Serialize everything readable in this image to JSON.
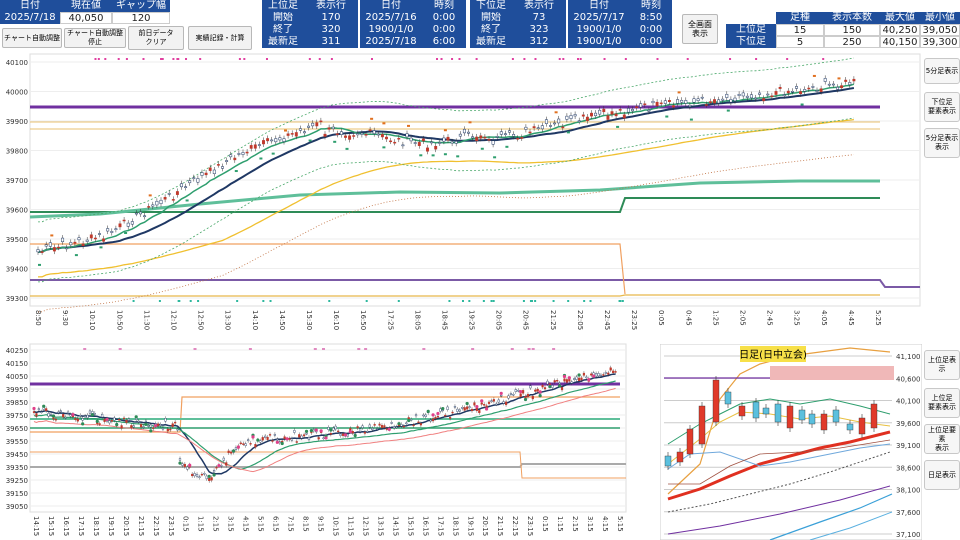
{
  "header": {
    "date_label": "日付",
    "date_value": "2025/7/18",
    "price_label": "現在値",
    "price_value": "40,050",
    "gap_label": "ギャップ幅",
    "gap_value": "120"
  },
  "buttons": {
    "auto_adjust": "チャート自動調整",
    "auto_adjust_stop": "チャート自動調整停止",
    "clear_prev": "前日データ\nクリア",
    "realtime": "実績記録・計算"
  },
  "upper_block": {
    "title": "上位足",
    "rows_label": "表示行",
    "start_label": "開始",
    "start_value": "170",
    "end_label": "終了",
    "end_value": "320",
    "latest_label": "最新足",
    "latest_value": "311",
    "date_label": "日付",
    "time_label": "時刻",
    "start_date": "2025/7/16",
    "start_time": "0:00",
    "end_date": "1900/1/0",
    "end_time": "0:00",
    "latest_date": "2025/7/18",
    "latest_time": "6:00"
  },
  "lower_block": {
    "title": "下位足",
    "rows_label": "表示行",
    "start_label": "開始",
    "start_value": "73",
    "end_label": "終了",
    "end_value": "323",
    "latest_label": "最新足",
    "latest_value": "312",
    "date_label": "日付",
    "time_label": "時刻",
    "start_date": "2025/7/17",
    "start_time": "8:50",
    "end_date": "1900/1/0",
    "end_time": "0:00",
    "latest_date": "1900/1/0",
    "latest_time": "0:00"
  },
  "fullscreen_button": "全画面\n表示",
  "summary": {
    "col_foot": "足種",
    "col_count": "表示本数",
    "col_max": "最大値",
    "col_min": "最小値",
    "rows": [
      {
        "label": "上位足",
        "foot": "15",
        "count": "150",
        "max": "40,250",
        "min": "39,050"
      },
      {
        "label": "下位足",
        "foot": "5",
        "count": "250",
        "max": "40,150",
        "min": "39,300"
      }
    ]
  },
  "side_buttons": {
    "upper": [
      "5分足表示",
      "下位足\n要素表示",
      "5分足表示\n表示"
    ],
    "lower": [
      "上位足表示",
      "上位足\n要素表示",
      "上位足要素\n表示",
      "日足表示"
    ]
  },
  "top_chart": {
    "y_ticks": [
      "40100",
      "40000",
      "39900",
      "39800",
      "39700",
      "39600",
      "39500",
      "39400",
      "39300"
    ],
    "x_ticks": [
      "8:50",
      "9:30",
      "10:10",
      "10:50",
      "11:30",
      "12:10",
      "12:50",
      "13:30",
      "14:10",
      "14:50",
      "15:30",
      "16:10",
      "16:50",
      "17:25",
      "18:05",
      "18:45",
      "19:25",
      "20:05",
      "20:45",
      "21:25",
      "22:05",
      "22:45",
      "23:25",
      "0:05",
      "0:45",
      "1:25",
      "2:05",
      "2:45",
      "3:25",
      "4:05",
      "4:45",
      "5:25"
    ]
  },
  "bottom_chart": {
    "y_ticks": [
      "40250",
      "40150",
      "40050",
      "39950",
      "39850",
      "39750",
      "39650",
      "39550",
      "39450",
      "39350",
      "39250",
      "39150",
      "39050"
    ],
    "x_ticks": [
      "14:15",
      "15:15",
      "16:15",
      "17:15",
      "18:15",
      "19:15",
      "20:15",
      "21:15",
      "22:15",
      "23:15",
      "0:15",
      "1:15",
      "2:15",
      "3:15",
      "4:15",
      "5:15",
      "6:15",
      "7:15",
      "8:15",
      "9:15",
      "10:15",
      "11:15",
      "12:15",
      "13:15",
      "14:15",
      "15:15",
      "16:15",
      "17:15",
      "18:15",
      "19:15",
      "20:15",
      "21:15",
      "22:15",
      "23:15",
      "0:15",
      "1:15",
      "2:15",
      "3:15",
      "4:15",
      "5:15"
    ]
  },
  "daily_chart": {
    "title": "日足(日中立会)",
    "y_ticks": [
      "41,100",
      "40,600",
      "40,100",
      "39,600",
      "39,100",
      "38,600",
      "38,100",
      "37,600",
      "37,100"
    ]
  },
  "colors": {
    "header_blue": "#1f4e9b",
    "purple": "#7030a0",
    "teal": "#2e9e6e",
    "orange": "#e89a2e",
    "navy": "#1f3864"
  }
}
